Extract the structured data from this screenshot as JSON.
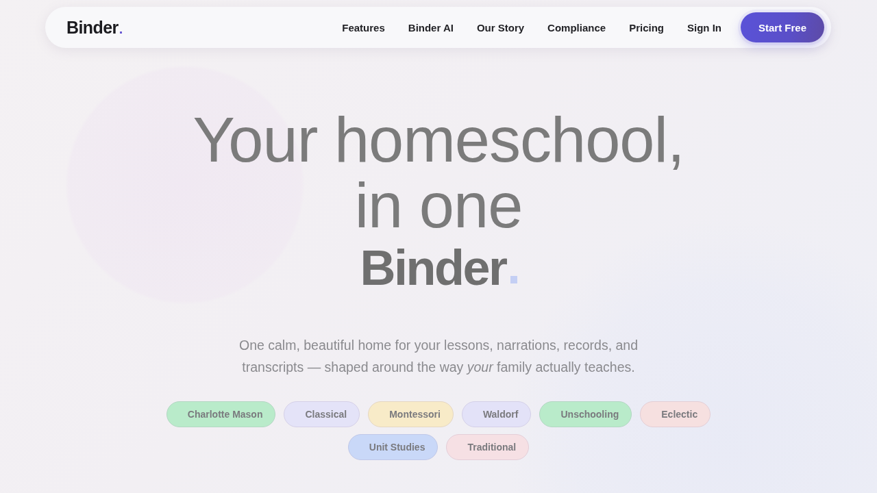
{
  "nav": {
    "logo": "Binder",
    "links": [
      "Features",
      "Binder AI",
      "Our Story",
      "Compliance",
      "Pricing",
      "Sign In"
    ],
    "cta": "Start Free"
  },
  "hero": {
    "headline_lines": [
      "Your homeschool,",
      "in one"
    ],
    "brand": "Binder",
    "subtitle": "One calm, beautiful home for your lessons, narrations, records, and transcripts — shaped around the way *your* family actually teaches.",
    "methods": [
      {
        "label": "Charlotte Mason",
        "color": "#b9ebca"
      },
      {
        "label": "Classical",
        "color": "#e4e3f8"
      },
      {
        "label": "Montessori",
        "color": "#f8ebc8"
      },
      {
        "label": "Waldorf",
        "color": "#e3e2f8"
      },
      {
        "label": "Unschooling",
        "color": "#b9ebca"
      },
      {
        "label": "Eclectic",
        "color": "#f6e0e0"
      },
      {
        "label": "Unit Studies",
        "color": "#c9d8f8"
      },
      {
        "label": "Traditional",
        "color": "#f6e0e4"
      }
    ]
  }
}
